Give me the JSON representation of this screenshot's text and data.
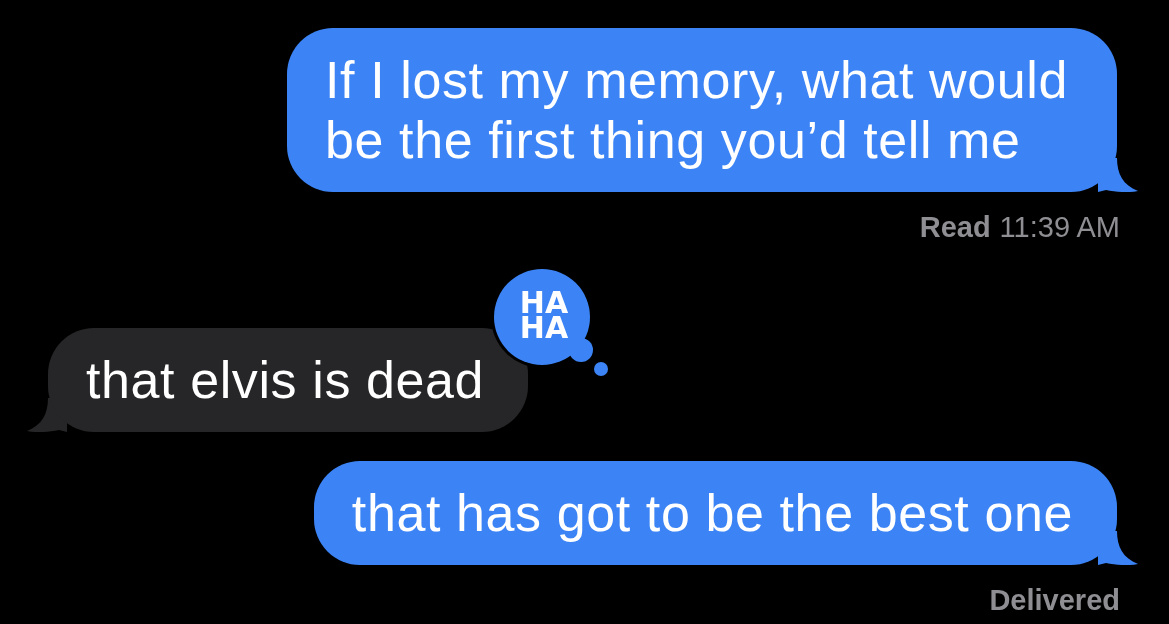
{
  "conversation": [
    {
      "kind": "sent",
      "text": "If I lost my memory, what would be the first thing you’d tell me",
      "receipt": {
        "kind": "read",
        "label": "Read",
        "time": "11:39 AM"
      }
    },
    {
      "kind": "received",
      "text": "that elvis is dead",
      "reaction": {
        "kind": "haha",
        "lines": [
          "HA",
          "HA"
        ]
      }
    },
    {
      "kind": "sent",
      "text": "that has got to be the best one",
      "receipt": {
        "kind": "delivered",
        "label": "Delivered"
      }
    }
  ]
}
